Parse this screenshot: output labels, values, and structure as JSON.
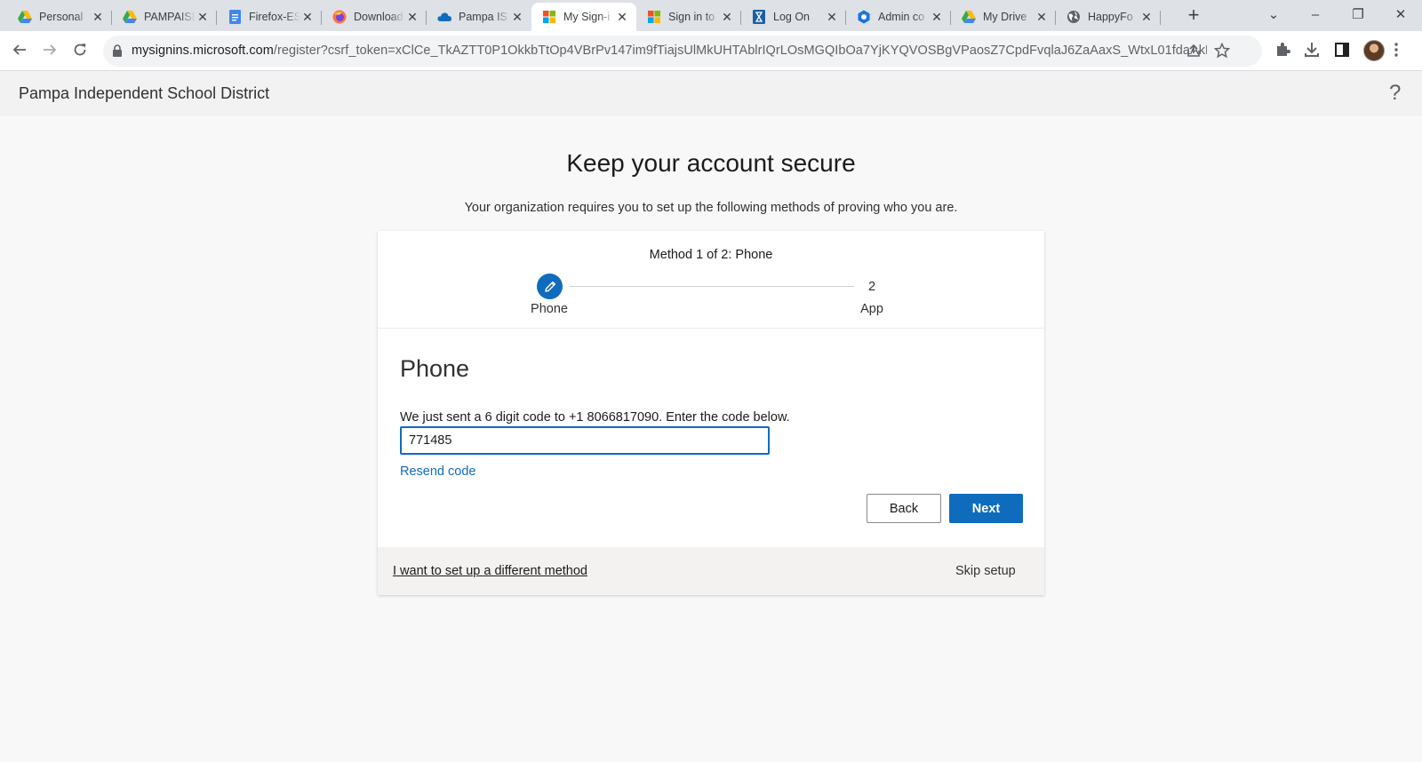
{
  "browser": {
    "tabs": [
      {
        "title": "Personal",
        "icon": "google-drive-icon"
      },
      {
        "title": "PAMPAISD",
        "icon": "google-drive-icon"
      },
      {
        "title": "Firefox-ES",
        "icon": "google-docs-icon"
      },
      {
        "title": "Download",
        "icon": "firefox-icon"
      },
      {
        "title": "Pampa IS",
        "icon": "onedrive-icon"
      },
      {
        "title": "My Sign-i",
        "icon": "microsoft-icon",
        "active": true
      },
      {
        "title": "Sign in to",
        "icon": "microsoft-icon"
      },
      {
        "title": "Log On",
        "icon": "hourglass-icon"
      },
      {
        "title": "Admin co",
        "icon": "admin-icon"
      },
      {
        "title": "My Drive",
        "icon": "google-drive-icon"
      },
      {
        "title": "HappyFo",
        "icon": "globe-icon"
      }
    ],
    "url_domain": "mysignins.microsoft.com",
    "url_path": "/register?csrf_token=xClCe_TkAZTT0P1OkkbTtOp4VBrPv147im9fTiajsUlMkUHTAblrIQrLOsMGQIbOa7YjKYQVOSBgVPaosZ7CpdFvqlaJ6ZaAaxS_WtxL01fdaAkLslgil..."
  },
  "page": {
    "org_name": "Pampa Independent School District",
    "help_symbol": "?",
    "title": "Keep your account secure",
    "subtitle": "Your organization requires you to set up the following methods of proving who you are."
  },
  "wizard": {
    "step_title": "Method 1 of 2: Phone",
    "steps": [
      {
        "number": "1",
        "label": "Phone",
        "state": "current"
      },
      {
        "number": "2",
        "label": "App",
        "state": "pending"
      }
    ],
    "accent_color": "#0f6cbd"
  },
  "phone": {
    "heading": "Phone",
    "instruction": "We just sent a 6 digit code to +1 8066817090. Enter the code below.",
    "code_value": "771485",
    "resend_label": "Resend code",
    "back_label": "Back",
    "next_label": "Next"
  },
  "footer": {
    "different_method_label": "I want to set up a different method",
    "skip_label": "Skip setup"
  }
}
